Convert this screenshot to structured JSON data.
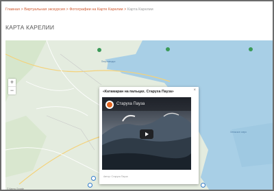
{
  "breadcrumb": {
    "items": [
      "Главная",
      "Виртуальная экскурсия",
      "Фотографии на Карте Карелии"
    ],
    "current": "Карта Карелии",
    "separator": ">"
  },
  "page_title": "КАРТА КАРЕЛИИ",
  "map": {
    "zoom_in": "+",
    "zoom_out": "−",
    "labels": [
      "Петрозаводск",
      "Онежское озеро"
    ],
    "attribution": "© Карты Google"
  },
  "popup": {
    "title": "«Катамаран на пальцах. Старуха Пауза»",
    "close": "×",
    "channel": "Старуха Пауза",
    "caption": "Автор: Старуха Пауза"
  },
  "colors": {
    "breadcrumb_link": "#d0582e",
    "water": "#a8cfe6",
    "land": "#e4ecdf",
    "pin": "#2d78c8"
  }
}
